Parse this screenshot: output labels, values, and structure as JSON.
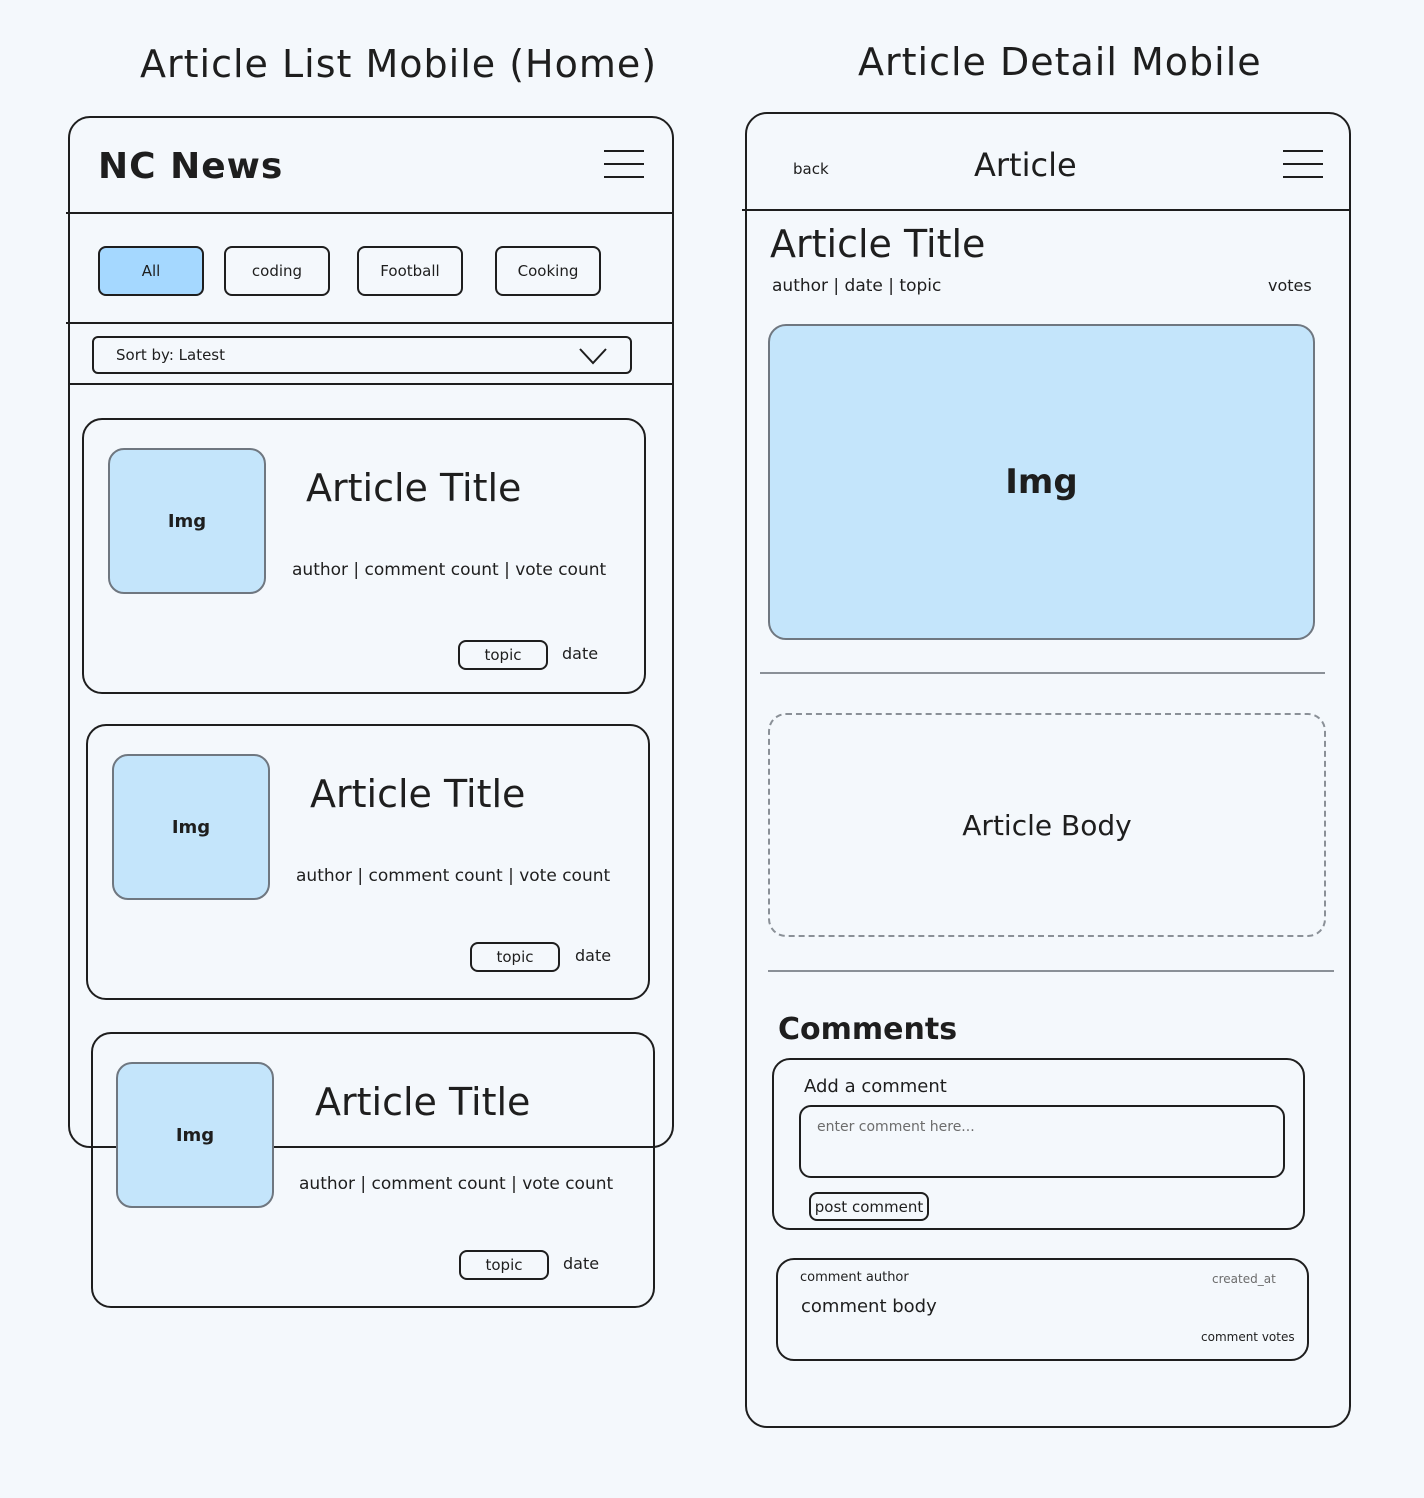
{
  "list_screen": {
    "frame_title": "Article List Mobile (Home)",
    "app_title": "NC News",
    "topics": [
      "All",
      "coding",
      "Football",
      "Cooking"
    ],
    "sort_label": "Sort by: Latest",
    "cards": [
      {
        "img": "Img",
        "title": "Article Title",
        "meta": "author | comment count | vote count",
        "topic": "topic",
        "date": "date"
      },
      {
        "img": "Img",
        "title": "Article Title",
        "meta": "author | comment count | vote count",
        "topic": "topic",
        "date": "date"
      },
      {
        "img": "Img",
        "title": "Article Title",
        "meta": "author | comment count | vote count",
        "topic": "topic",
        "date": "date"
      }
    ]
  },
  "detail_screen": {
    "frame_title": "Article Detail Mobile",
    "back_label": "back",
    "header_title": "Article",
    "article_title": "Article Title",
    "meta": "author | date | topic",
    "votes": "votes",
    "img": "Img",
    "body": "Article Body",
    "comments_heading": "Comments",
    "add_comment_label": "Add a comment",
    "comment_placeholder": "enter comment here...",
    "post_button": "post comment",
    "comment": {
      "author": "comment author",
      "created_at": "created_at",
      "body": "comment body",
      "votes": "comment votes"
    }
  },
  "colors": {
    "background": "#f4f8fc",
    "image_fill": "#c4e5fb",
    "selected_chip": "#a5d8ff",
    "stroke": "#1e1e1e"
  },
  "icons": [
    "hamburger-menu-icon",
    "chevron-down-icon"
  ]
}
